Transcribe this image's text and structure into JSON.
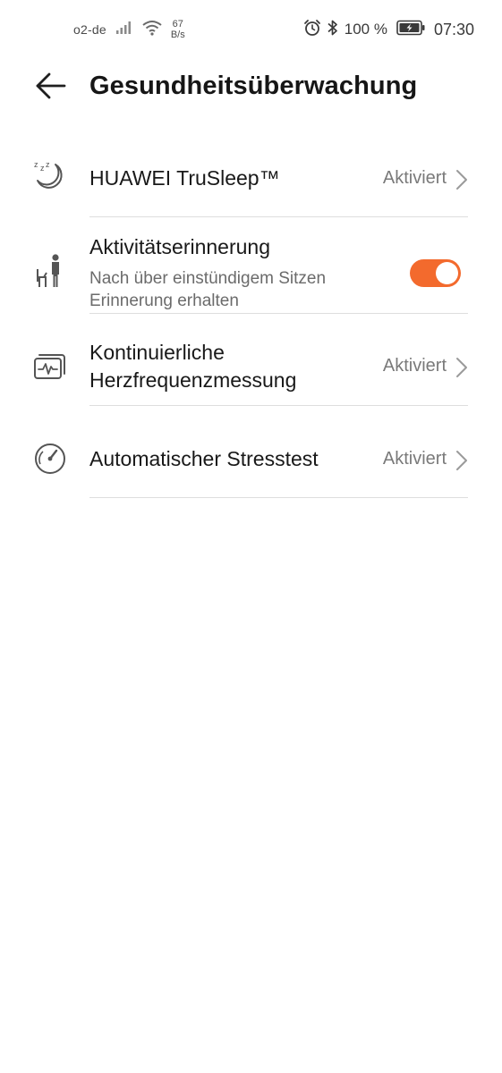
{
  "status_bar": {
    "carrier": "o2-de",
    "net_speed_value": "67",
    "net_speed_unit": "B/s",
    "battery_percent": "100 %",
    "time": "07:30",
    "icons": [
      "signal-icon",
      "wifi-icon",
      "alarm-icon",
      "bluetooth-icon",
      "battery-charging-icon"
    ]
  },
  "header": {
    "title": "Gesundheitsüberwachung",
    "back_icon": "back-arrow-icon"
  },
  "settings": {
    "items": [
      {
        "title": "HUAWEI TruSleep™",
        "status": "Aktiviert",
        "icon": "sleep-moon-icon"
      },
      {
        "title": "Aktivitätserinnerung",
        "subtitle_line1": "Nach über einstündigem Sitzen",
        "subtitle_line2": "Erinnerung erhalten",
        "icon": "sitting-person-icon",
        "toggle_on": true
      },
      {
        "title_line1": "Kontinuierliche",
        "title_line2": "Herzfrequenzmessung",
        "status": "Aktiviert",
        "icon": "heart-rate-monitor-icon"
      },
      {
        "title": "Automatischer Stresstest",
        "status": "Aktiviert",
        "icon": "stress-gauge-icon"
      }
    ]
  },
  "colors": {
    "accent": "#f36a2d",
    "text_primary": "#191919",
    "text_secondary": "#7a7a7a",
    "divider": "#dedede"
  }
}
